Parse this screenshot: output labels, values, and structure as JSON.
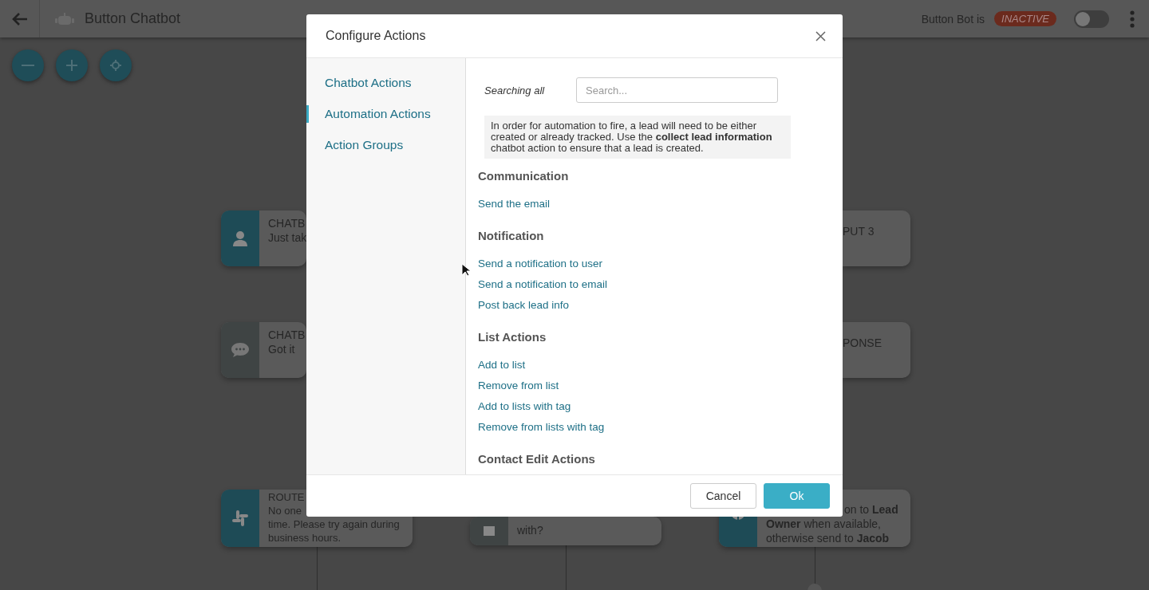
{
  "topbar": {
    "title": "Button Chatbot",
    "status_label": "Button Bot is",
    "status": "INACTIVE",
    "active": false
  },
  "zoom_controls": [
    {
      "kind": "minus"
    },
    {
      "kind": "plus"
    },
    {
      "kind": "center"
    }
  ],
  "nodes": [
    {
      "kind": "contact",
      "accent": true,
      "lines": [
        "CHATB",
        "Just tak"
      ]
    },
    {
      "kind": "message",
      "accent": false,
      "lines": [
        "CHATB",
        "Got it"
      ]
    },
    {
      "kind": "route",
      "accent": true,
      "lines": [
        "ROUTE",
        "No one",
        "time. Please try again during",
        "business hours."
      ]
    },
    {
      "kind": "reply",
      "accent": false,
      "lines": [
        "with?"
      ]
    },
    {
      "kind": "notify",
      "accent": true,
      "lines": [
        "on to **Lead**",
        "**Owner** when available,",
        "otherwise send to **Jacob**"
      ]
    },
    {
      "kind": "fragment",
      "lines": [
        "PUT 3"
      ]
    },
    {
      "kind": "fragment",
      "lines": [
        "PONSE"
      ]
    }
  ],
  "dialog": {
    "title": "Configure Actions",
    "tabs": [
      {
        "label": "Chatbot Actions",
        "selected": false
      },
      {
        "label": "Automation Actions",
        "selected": true
      },
      {
        "label": "Action Groups",
        "selected": false
      }
    ],
    "search_label": "Searching all",
    "search": {
      "placeholder": "Search..."
    },
    "notice": "In order for automation to fire, a lead will need to be either created or already tracked. Use the **collect lead information** chatbot action to ensure that a lead is created.",
    "sections": [
      {
        "title": "Communication",
        "actions": [
          "Send the email"
        ]
      },
      {
        "title": "Notification",
        "actions": [
          "Send a notification to user",
          "Send a notification to email",
          "Post back lead info"
        ]
      },
      {
        "title": "List Actions",
        "actions": [
          "Add to list",
          "Remove from list",
          "Add to lists with tag",
          "Remove from lists with tag"
        ]
      },
      {
        "title": "Contact Edit Actions"
      }
    ],
    "buttons": [
      {
        "label": "Cancel",
        "kind": "secondary"
      },
      {
        "label": "Ok",
        "kind": "primary"
      }
    ]
  }
}
